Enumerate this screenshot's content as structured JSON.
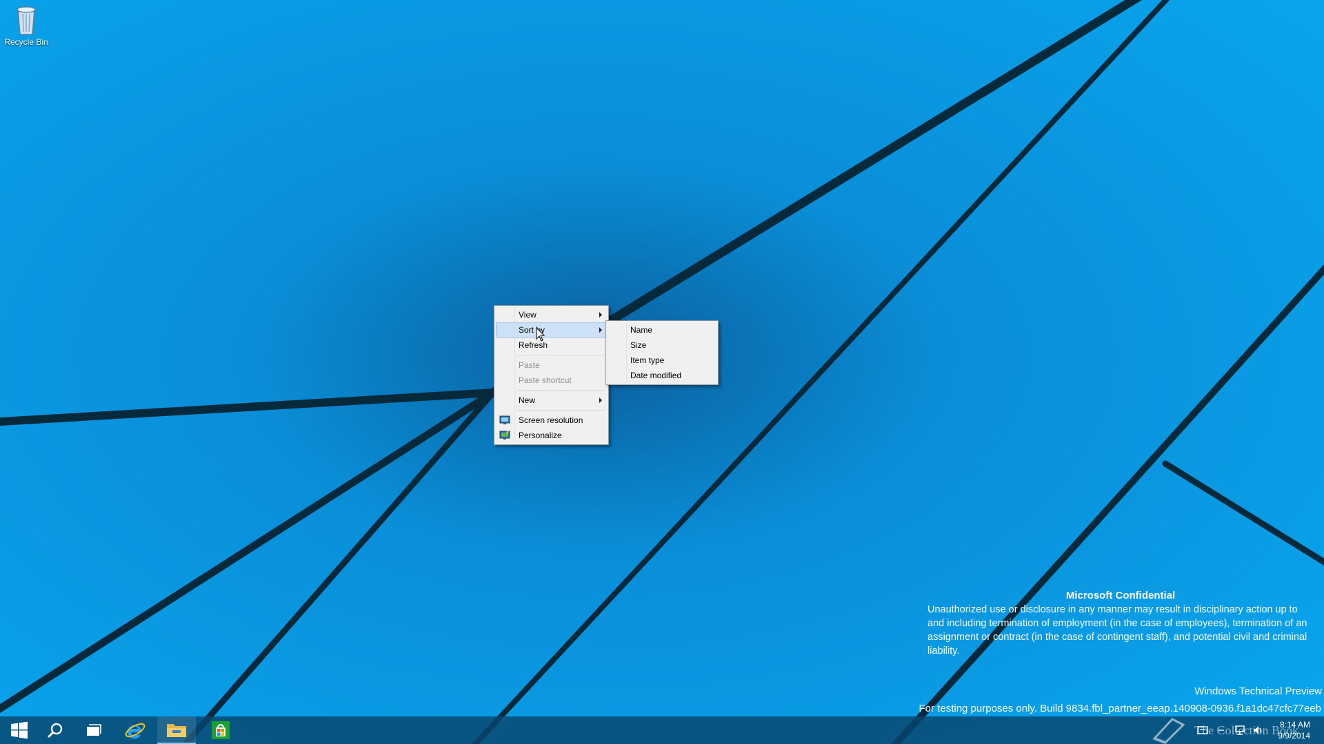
{
  "desktop": {
    "icons": [
      {
        "label": "Recycle Bin",
        "icon": "recycle-bin-icon"
      }
    ]
  },
  "context_menu": {
    "items": {
      "view": "View",
      "sort_by": "Sort by",
      "refresh": "Refresh",
      "paste": "Paste",
      "paste_shortcut": "Paste shortcut",
      "new": "New",
      "screen_resolution": "Screen resolution",
      "personalize": "Personalize"
    },
    "highlighted": "Sort by"
  },
  "sort_submenu": {
    "items": [
      "Name",
      "Size",
      "Item type",
      "Date modified"
    ]
  },
  "watermark": {
    "title": "Microsoft Confidential",
    "body": "Unauthorized use or disclosure in any manner may result in disciplinary action up to and including termination of employment (in the case of employees), termination of an assignment or contract (in the case of contingent staff), and potential civil and criminal liability.",
    "edition": "Windows Technical Preview",
    "build": "For testing purposes only. Build 9834.fbl_partner_eeap.140908-0936.f1a1dc47cfc77eeb"
  },
  "taskbar": {
    "buttons": [
      "start-icon",
      "search-icon",
      "task-view-icon",
      "internet-explorer-icon",
      "file-explorer-icon",
      "store-icon"
    ],
    "clock_time": "8:14 AM",
    "clock_date": "9/9/2014",
    "overlay_text": "The Collection Book"
  },
  "colors": {
    "wallpaper": "#0a96e8",
    "menu_highlight": "#cce1f7",
    "taskbar": "#08466e"
  }
}
